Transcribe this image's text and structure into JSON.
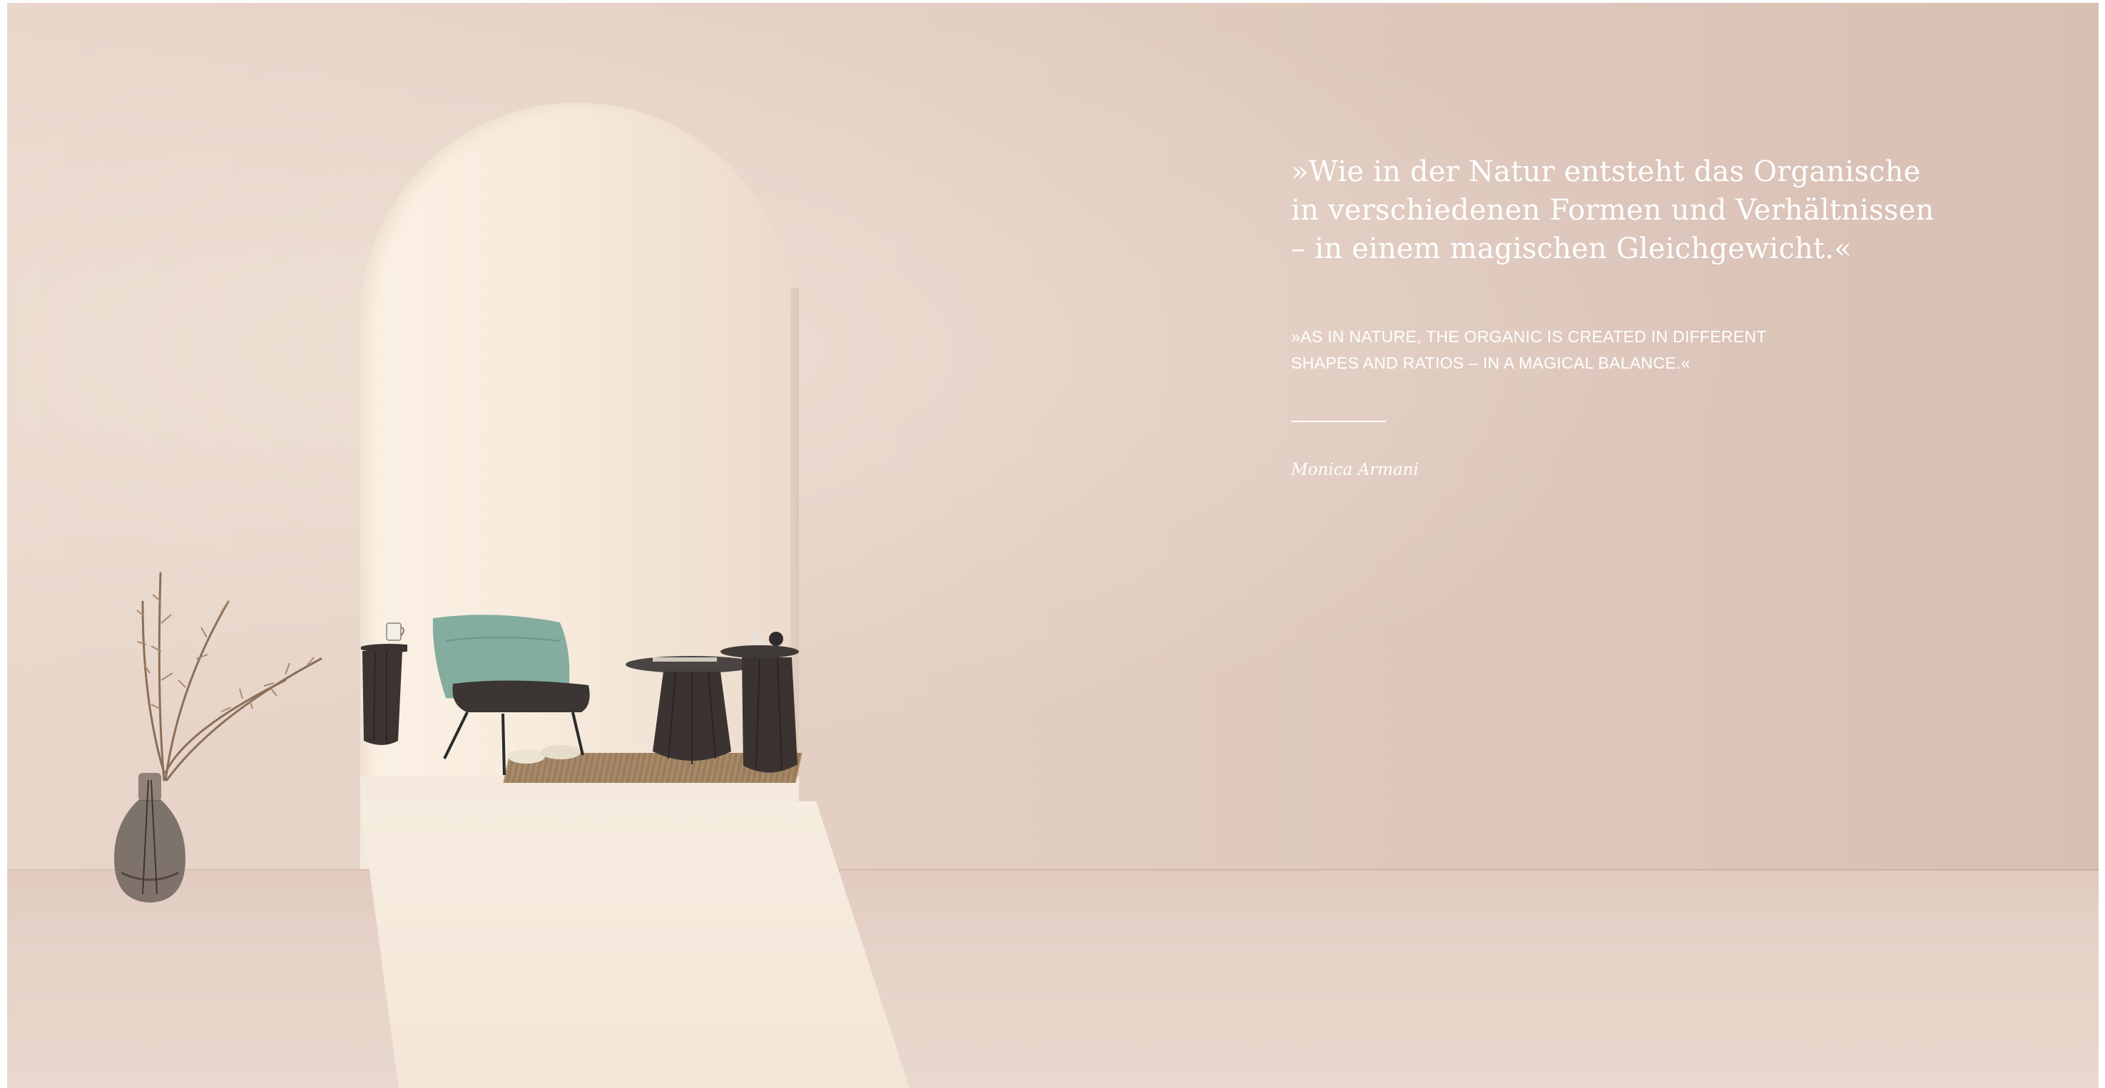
{
  "quote": {
    "german_lines": [
      "»Wie in der Natur entsteht das Organische",
      "in verschiedenen Formen und Verhältnissen",
      "– in einem magischen Gleichgewicht.«"
    ],
    "english_lines": [
      "»AS IN NATURE, THE ORGANIC IS CREATED IN DIFFERENT",
      "SHAPES AND RATIOS – IN A MAGICAL BALANCE.«"
    ],
    "author": "Monica Armani"
  },
  "colors": {
    "wall": "#e3cfc3",
    "arch_light": "#f6eadc",
    "chair": "#7fa89a",
    "furniture_dark": "#3a3331",
    "text": "#ffffff"
  }
}
